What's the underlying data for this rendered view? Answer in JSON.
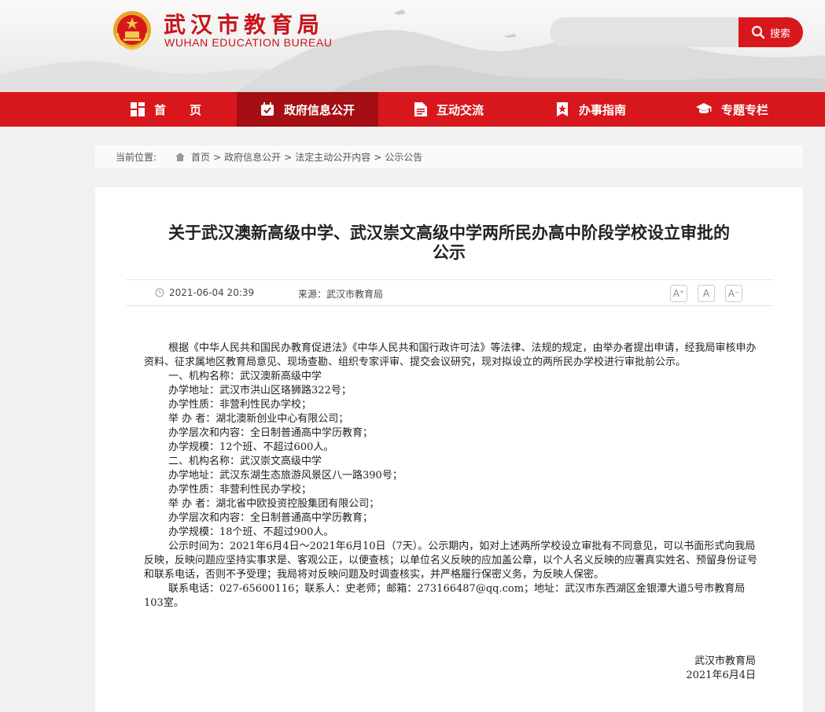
{
  "header": {
    "logo_cn": "武汉市教育局",
    "logo_en": "WUHAN EDUCATION BUREAU",
    "search_placeholder": "",
    "search_label": "搜索"
  },
  "nav": [
    {
      "label": "首　　页",
      "icon": "home-grid-icon",
      "active": false
    },
    {
      "label": "政府信息公开",
      "icon": "calendar-check-icon",
      "active": true
    },
    {
      "label": "互动交流",
      "icon": "document-icon",
      "active": false
    },
    {
      "label": "办事指南",
      "icon": "star-badge-icon",
      "active": false
    },
    {
      "label": "专题专栏",
      "icon": "graduation-cap-icon",
      "active": false
    }
  ],
  "breadcrumb": {
    "label": "当前位置:",
    "items": [
      "首页",
      "政府信息公开",
      "法定主动公开内容",
      "公示公告"
    ],
    "sep": ">"
  },
  "article": {
    "title_line1": "关于武汉澳新高级中学、武汉崇文高级中学两所民办高中阶段学校设立审批的",
    "title_line2": "公示",
    "date": "2021-06-04 20:39",
    "source": "来源：武汉市教育局",
    "font_buttons": [
      "A⁺",
      "A",
      "A⁻"
    ],
    "paragraphs": [
      {
        "text": "根据《中华人民共和国民办教育促进法》《中华人民共和国行政许可法》等法律、法规的规定，由举办者提出申请，经我局审核申办资料、征求属地区教育局意见、现场查勘、组织专家评审、提交会议研究，现对拟设立的两所民办学校进行审批前公示。",
        "indent": true
      },
      {
        "text": "一、机构名称：武汉澳新高级中学",
        "indent": true
      },
      {
        "text": "办学地址：武汉市洪山区珞狮路322号；",
        "indent": true
      },
      {
        "text": "办学性质：非营利性民办学校；",
        "indent": true
      },
      {
        "text": "举 办 者：湖北澳新创业中心有限公司；",
        "indent": true
      },
      {
        "text": "办学层次和内容：全日制普通高中学历教育；",
        "indent": true
      },
      {
        "text": "办学规模：12个班、不超过600人。",
        "indent": true
      },
      {
        "text": "二、机构名称：武汉崇文高级中学",
        "indent": true
      },
      {
        "text": "办学地址：武汉东湖生态旅游风景区八一路390号；",
        "indent": true
      },
      {
        "text": "办学性质：非营利性民办学校；",
        "indent": true
      },
      {
        "text": "举 办 者：湖北省中欧投资控股集团有限公司；",
        "indent": true
      },
      {
        "text": "办学层次和内容：全日制普通高中学历教育；",
        "indent": true
      },
      {
        "text": "办学规模：18个班、不超过900人。",
        "indent": true
      },
      {
        "text": "公示时间为：2021年6月4日～2021年6月10日（7天）。公示期内，如对上述两所学校设立审批有不同意见，可以书面形式向我局反映，反映问题应坚持实事求是、客观公正，以便查核；以单位名义反映的应加盖公章，以个人名义反映的应署真实姓名、预留身份证号和联系电话，否则不予受理；我局将对反映问题及时调查核实，并严格履行保密义务，为反映人保密。",
        "indent": true
      },
      {
        "text": "联系电话：027-65600116；联系人：史老师；邮箱：273166487@qq.com；地址：武汉市东西湖区金银潭大道5号市教育局103室。",
        "indent": true
      }
    ],
    "sign_org": "武汉市教育局",
    "sign_date": "2021年6月4日"
  }
}
